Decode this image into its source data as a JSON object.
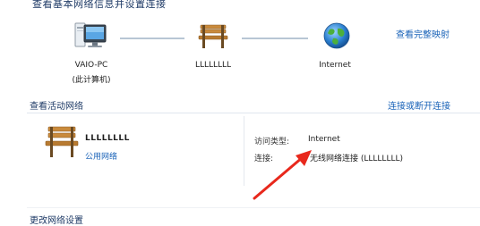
{
  "header": {
    "title": "查看基本网络信息并设置连接",
    "full_map_link": "查看完整映射"
  },
  "network_map": {
    "computer": {
      "name": "VAIO-PC",
      "subtitle": "(此计算机)"
    },
    "network": {
      "name": "LLLLLLLL"
    },
    "internet": {
      "name": "Internet"
    }
  },
  "active_networks": {
    "title": "查看活动网络",
    "connect_link": "连接或断开连接",
    "network_name": "LLLLLLLL",
    "network_category": "公用网络",
    "access_type_label": "访问类型:",
    "access_type_value": "Internet",
    "connections_label": "连接:",
    "connections_value": "无线网络连接 (LLLLLLLL)"
  },
  "change_settings": {
    "title": "更改网络设置"
  },
  "colors": {
    "link": "#1a63b8",
    "heading": "#1e3a66",
    "connector": "#b8c6d4",
    "arrow": "#e8281c"
  }
}
